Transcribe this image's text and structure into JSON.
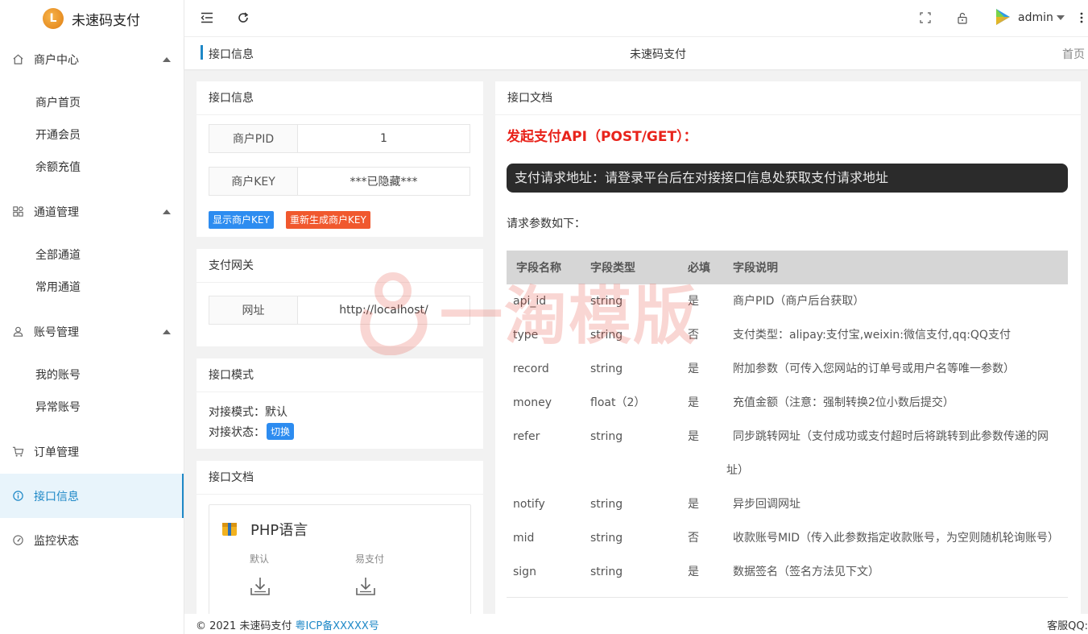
{
  "brand": {
    "name": "未速码支付",
    "logo_char": "L"
  },
  "sidebar": {
    "groups": [
      {
        "label": "商户中心",
        "icon": "home-icon",
        "children": [
          "商户首页",
          "开通会员",
          "余额充值"
        ]
      },
      {
        "label": "通道管理",
        "icon": "apps-icon",
        "children": [
          "全部通道",
          "常用通道"
        ]
      },
      {
        "label": "账号管理",
        "icon": "user-icon",
        "children": [
          "我的账号",
          "异常账号"
        ]
      }
    ],
    "items": [
      {
        "label": "订单管理",
        "icon": "cart-icon"
      },
      {
        "label": "接口信息",
        "icon": "info-icon",
        "active": true
      },
      {
        "label": "监控状态",
        "icon": "gauge-icon"
      }
    ]
  },
  "topbar": {
    "username": "admin"
  },
  "breadcrumb": {
    "title": "接口信息",
    "center": "未速码支付",
    "home": "首页"
  },
  "info_card": {
    "title": "接口信息",
    "pid_label": "商户PID",
    "pid_value": "1",
    "key_label": "商户KEY",
    "key_value": "***已隐藏***",
    "show_key_btn": "显示商户KEY",
    "regen_key_btn": "重新生成商户KEY"
  },
  "gateway_card": {
    "title": "支付网关",
    "url_label": "网址",
    "url_value": "http://localhost/"
  },
  "mode_card": {
    "title": "接口模式",
    "mode_label": "对接模式：",
    "mode_value": "默认",
    "status_label": "对接状态：",
    "switch_btn": "切换"
  },
  "sdk_card": {
    "title": "接口文档",
    "lang": "PHP语言",
    "downloads": [
      "默认",
      "易支付"
    ]
  },
  "docs": {
    "title": "接口文档",
    "api_title": "发起支付API（POST/GET）：",
    "api_url_note": "支付请求地址：请登录平台后在对接接口信息处获取支付请求地址",
    "params_label": "请求参数如下：",
    "headers": [
      "字段名称",
      "字段类型",
      "必填",
      "字段说明"
    ],
    "rows": [
      [
        "api_id",
        "string",
        "是",
        "商户PID（商户后台获取）"
      ],
      [
        "type",
        "string",
        "否",
        "支付类型：alipay:支付宝,weixin:微信支付,qq:QQ支付"
      ],
      [
        "record",
        "string",
        "是",
        "附加参数（可传入您网站的订单号或用户名等唯一参数）"
      ],
      [
        "money",
        "float（2）",
        "是",
        "充值金额（注意：强制转换2位小数后提交）"
      ],
      [
        "refer",
        "string",
        "是",
        "同步跳转网址（支付成功或支付超时后将跳转到此参数传递的网",
        "址）"
      ],
      [
        "notify",
        "string",
        "是",
        "异步回调网址"
      ],
      [
        "mid",
        "string",
        "否",
        "收款账号MID（传入此参数指定收款账号，为空则随机轮询账号）"
      ],
      [
        "sign",
        "string",
        "是",
        "数据签名（签名方法见下文）"
      ]
    ]
  },
  "watermark": {
    "text": "一淘模版"
  },
  "footer": {
    "copy": "© 2021 未速码支付",
    "icp": "粤ICP备XXXXX号",
    "qq": "客服QQ:"
  },
  "colors": {
    "accent": "#1e88c7",
    "danger_btn": "#f0582e",
    "api_red": "#e8231b",
    "dark_box": "#2b2b2b"
  }
}
